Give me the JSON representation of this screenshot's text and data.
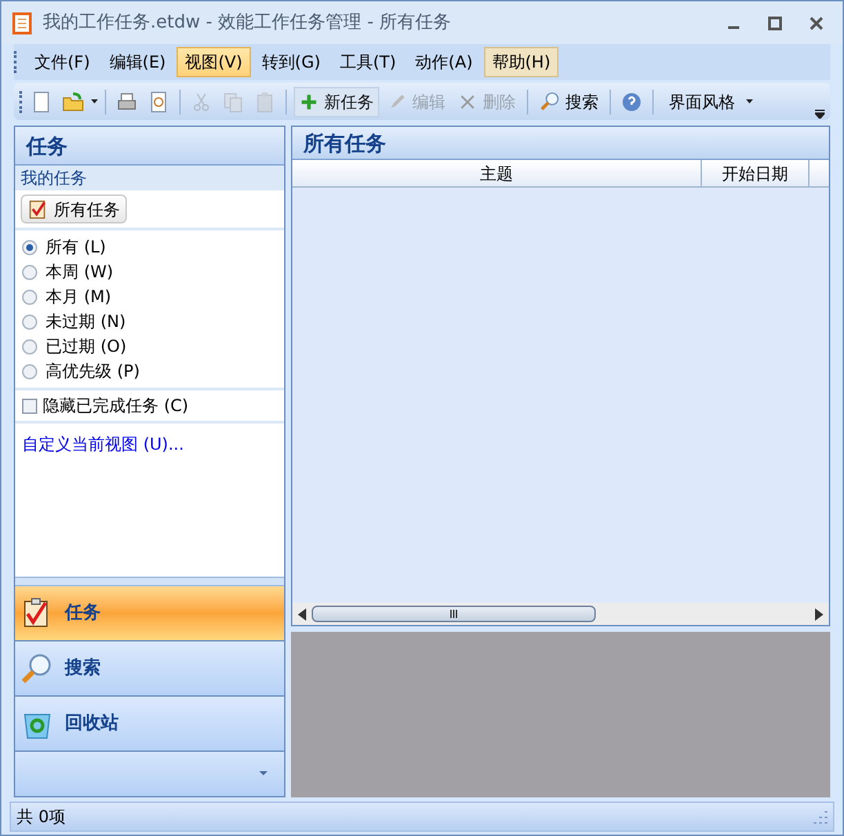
{
  "window": {
    "title": "我的工作任务.etdw - 效能工作任务管理 - 所有任务"
  },
  "menu": [
    {
      "label": "文件(F)",
      "selected": false,
      "hot": false
    },
    {
      "label": "编辑(E)",
      "selected": false,
      "hot": false
    },
    {
      "label": "视图(V)",
      "selected": true,
      "hot": false
    },
    {
      "label": "转到(G)",
      "selected": false,
      "hot": false
    },
    {
      "label": "工具(T)",
      "selected": false,
      "hot": false
    },
    {
      "label": "动作(A)",
      "selected": false,
      "hot": false
    },
    {
      "label": "帮助(H)",
      "selected": false,
      "hot": true
    }
  ],
  "toolbar": {
    "file_tools": [
      {
        "disabled": false
      },
      {
        "disabled": false
      },
      {
        "disabled": false
      },
      {
        "disabled": false
      }
    ],
    "edit_tools": [
      {
        "disabled": true
      },
      {
        "disabled": true
      },
      {
        "disabled": true
      }
    ],
    "task_buttons": [
      {
        "label": "新任务",
        "disabled": false
      },
      {
        "label": "编辑",
        "disabled": true
      },
      {
        "label": "删除",
        "disabled": true
      }
    ],
    "search_button": {
      "label": "搜索"
    },
    "style_menu": {
      "label": "界面风格"
    }
  },
  "sidebar": {
    "title": "任务",
    "section": "我的任务",
    "all_tasks_button": "所有任务",
    "filters": [
      {
        "label": "所有 (L)",
        "selected": true
      },
      {
        "label": "本周 (W)",
        "selected": false
      },
      {
        "label": "本月 (M)",
        "selected": false
      },
      {
        "label": "未过期 (N)",
        "selected": false
      },
      {
        "label": "已过期 (O)",
        "selected": false
      },
      {
        "label": "高优先级 (P)",
        "selected": false
      }
    ],
    "hide_completed": {
      "label": "隐藏已完成任务 (C)",
      "checked": false
    },
    "customize_link": "自定义当前视图 (U)...",
    "nav": [
      {
        "label": "任务",
        "selected": true
      },
      {
        "label": "搜索",
        "selected": false
      },
      {
        "label": "回收站",
        "selected": false
      }
    ]
  },
  "main": {
    "title": "所有任务",
    "table": {
      "columns": [
        "主题",
        "开始日期"
      ]
    }
  },
  "status_bar": {
    "text": "共 0项"
  }
}
